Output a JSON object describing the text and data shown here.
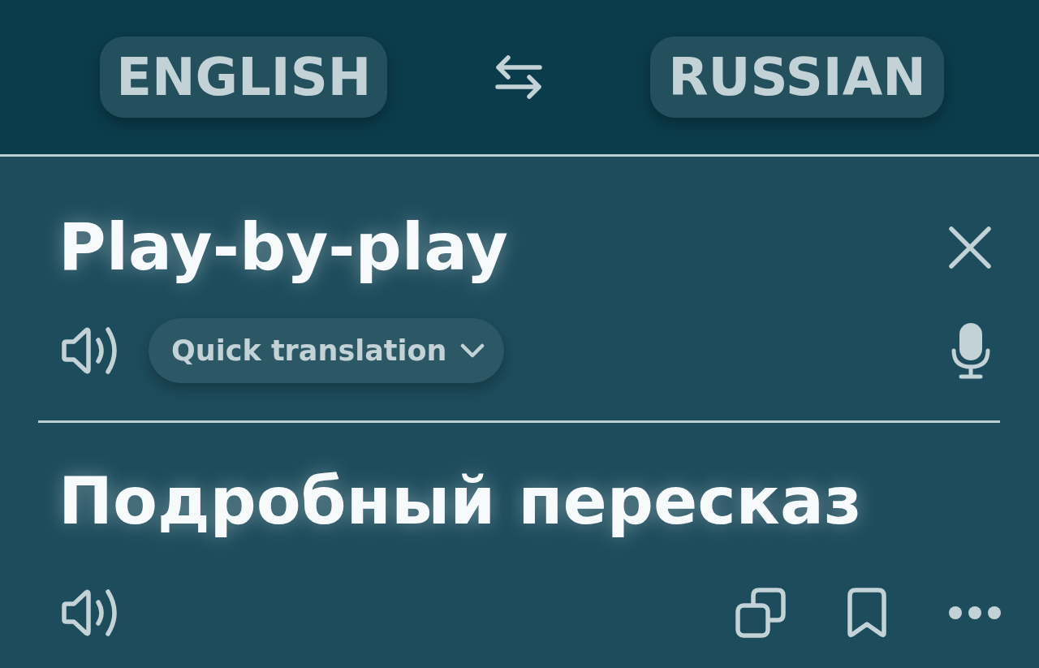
{
  "languages": {
    "source": {
      "label": "ENGLISH"
    },
    "target": {
      "label": "RUSSIAN"
    }
  },
  "source": {
    "text": "Play-by-play",
    "mode": {
      "label": "Quick translation"
    }
  },
  "translation": {
    "text": "Подробный пересказ"
  }
}
